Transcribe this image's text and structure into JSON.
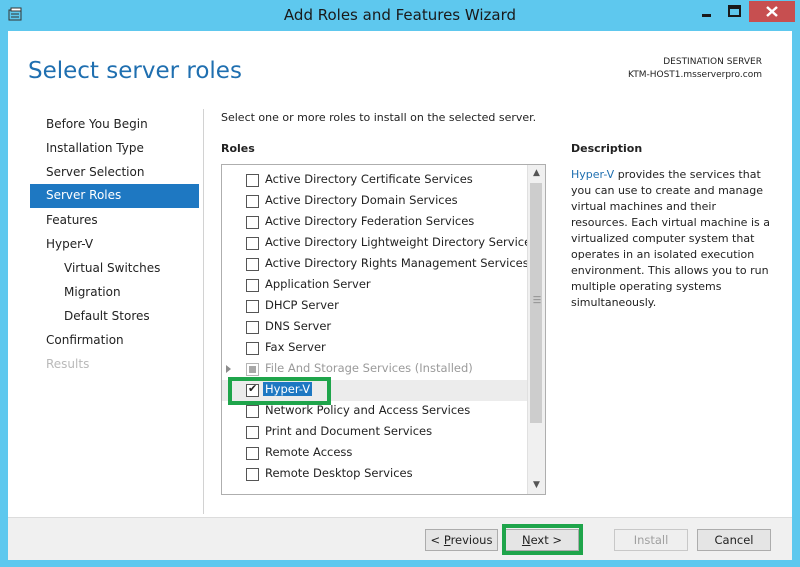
{
  "window": {
    "title": "Add Roles and Features Wizard",
    "controls": {
      "minimize": "minimize",
      "maximize": "maximize",
      "close": "close"
    }
  },
  "header": {
    "title": "Select server roles",
    "destination_label": "DESTINATION SERVER",
    "destination_server": "KTM-HOST1.msserverpro.com"
  },
  "nav": {
    "items": [
      {
        "label": "Before You Begin",
        "state": "normal",
        "level": 0
      },
      {
        "label": "Installation Type",
        "state": "normal",
        "level": 0
      },
      {
        "label": "Server Selection",
        "state": "normal",
        "level": 0
      },
      {
        "label": "Server Roles",
        "state": "active",
        "level": 0
      },
      {
        "label": "Features",
        "state": "normal",
        "level": 0
      },
      {
        "label": "Hyper-V",
        "state": "normal",
        "level": 0
      },
      {
        "label": "Virtual Switches",
        "state": "normal",
        "level": 1
      },
      {
        "label": "Migration",
        "state": "normal",
        "level": 1
      },
      {
        "label": "Default Stores",
        "state": "normal",
        "level": 1
      },
      {
        "label": "Confirmation",
        "state": "normal",
        "level": 0
      },
      {
        "label": "Results",
        "state": "disabled",
        "level": 0
      }
    ]
  },
  "main": {
    "instruction": "Select one or more roles to install on the selected server.",
    "roles_label": "Roles",
    "roles": [
      {
        "label": "Active Directory Certificate Services",
        "checked": false
      },
      {
        "label": "Active Directory Domain Services",
        "checked": false
      },
      {
        "label": "Active Directory Federation Services",
        "checked": false
      },
      {
        "label": "Active Directory Lightweight Directory Services",
        "checked": false
      },
      {
        "label": "Active Directory Rights Management Services",
        "checked": false
      },
      {
        "label": "Application Server",
        "checked": false
      },
      {
        "label": "DHCP Server",
        "checked": false
      },
      {
        "label": "DNS Server",
        "checked": false
      },
      {
        "label": "Fax Server",
        "checked": false
      },
      {
        "label": "File And Storage Services (Installed)",
        "checked": "partial",
        "expandable": true,
        "disabled": true
      },
      {
        "label": "Hyper-V",
        "checked": true,
        "selected": true
      },
      {
        "label": "Network Policy and Access Services",
        "checked": false
      },
      {
        "label": "Print and Document Services",
        "checked": false
      },
      {
        "label": "Remote Access",
        "checked": false
      },
      {
        "label": "Remote Desktop Services",
        "checked": false
      }
    ]
  },
  "description": {
    "label": "Description",
    "link_text": "Hyper-V",
    "text": " provides the services that you can use to create and manage virtual machines and their resources. Each virtual machine is a virtualized computer system that operates in an isolated execution environment. This allows you to run multiple operating systems simultaneously."
  },
  "footer": {
    "previous": {
      "prefix": "< ",
      "mnemonic": "P",
      "rest": "revious"
    },
    "next": {
      "mnemonic": "N",
      "rest": "ext >"
    },
    "install": "Install",
    "cancel": "Cancel"
  },
  "colors": {
    "titlebar": "#5ec8ee",
    "accent": "#1e78c2",
    "highlight_border": "#1fa54b",
    "close_button": "#c74f50"
  }
}
